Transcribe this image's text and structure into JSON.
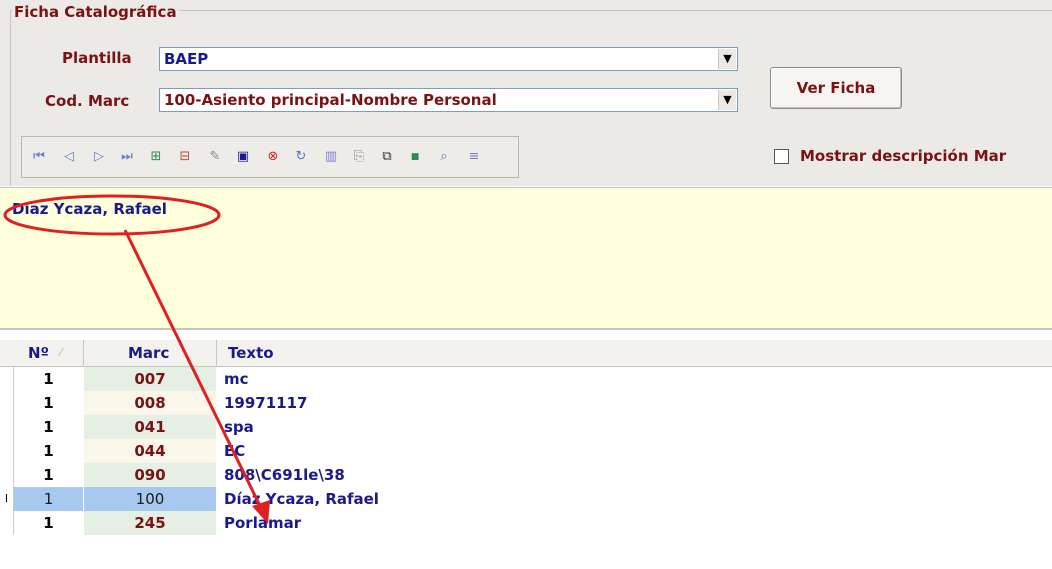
{
  "section_title": "Ficha Catalográfica",
  "plantilla": {
    "label": "Plantilla",
    "value": "BAEP"
  },
  "cod_marc": {
    "label": "Cod. Marc",
    "value": "100-Asiento principal-Nombre Personal"
  },
  "ver_ficha_button": "Ver Ficha",
  "mostrar_checkbox_label": "Mostrar descripción Mar",
  "toolbar_icons": [
    "first-icon",
    "prev-icon",
    "next-icon",
    "last-icon",
    "insert-icon",
    "delete-icon",
    "edit-icon",
    "save-icon",
    "cancel-icon",
    "refresh-icon",
    "columns-icon",
    "paste-icon",
    "copy-icon",
    "xls-icon",
    "search-icon",
    "list-icon"
  ],
  "memo_text": "Díaz Ycaza, Rafael",
  "grid": {
    "headers": [
      "Nº",
      "Marc",
      "Texto"
    ],
    "rows": [
      {
        "n": "1",
        "marc": "007",
        "texto": "mc"
      },
      {
        "n": "1",
        "marc": "008",
        "texto": "19971117"
      },
      {
        "n": "1",
        "marc": "041",
        "texto": "spa"
      },
      {
        "n": "1",
        "marc": "044",
        "texto": "EC"
      },
      {
        "n": "1",
        "marc": "090",
        "texto": "808\\C691le\\38"
      },
      {
        "n": "1",
        "marc": "100",
        "texto": "Díaz Ycaza, Rafael"
      },
      {
        "n": "1",
        "marc": "245",
        "texto": "Porlamar"
      }
    ],
    "selected_row": 5,
    "row_indicator": "I"
  },
  "colors": {
    "label": "#7a1212",
    "value": "#1a1a8c",
    "memo_bg": "#ffffdc",
    "annotation": "#e02020"
  }
}
